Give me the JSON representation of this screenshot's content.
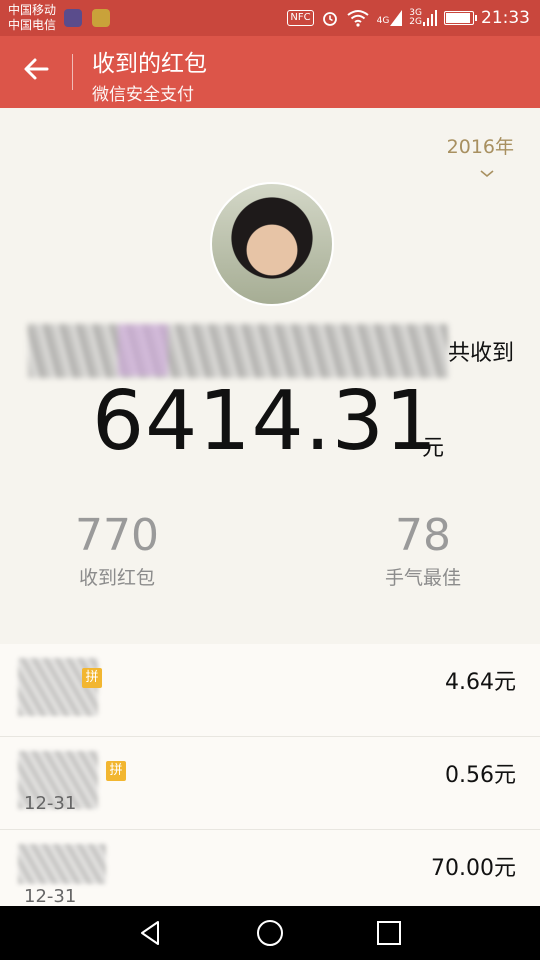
{
  "status_bar": {
    "carrier_1": "中国移动",
    "carrier_2": "中国电信",
    "nfc": "NFC",
    "net_1_top": "4G",
    "net_2_top": "3G",
    "net_2_bottom": "2G",
    "battery_level": 0.85,
    "time": "21:33"
  },
  "header": {
    "back_icon": "arrow-left-icon",
    "title": "收到的红包",
    "subtitle": "微信安全支付"
  },
  "summary": {
    "year": "2016年",
    "year_chevron": "chevron-down-icon",
    "received_label": "共收到",
    "total_amount": "6414.31",
    "total_unit": "元",
    "stats": [
      {
        "value": "770",
        "label": "收到红包"
      },
      {
        "value": "78",
        "label": "手气最佳"
      }
    ]
  },
  "list": {
    "rows": [
      {
        "badge": "拼",
        "amount": "4.64元",
        "date": ""
      },
      {
        "badge": "拼",
        "amount": "0.56元",
        "date": "12-31"
      },
      {
        "badge": "",
        "amount": "70.00元",
        "date": "12-31"
      }
    ]
  },
  "nav": {
    "back": "triangle-back-icon",
    "home": "circle-home-icon",
    "recent": "square-recent-icon"
  },
  "colors": {
    "status_bar": "#c9473d",
    "app_bar": "#dc5549",
    "background": "#f6f4ee",
    "badge": "#f2b630",
    "year": "#a89060"
  }
}
